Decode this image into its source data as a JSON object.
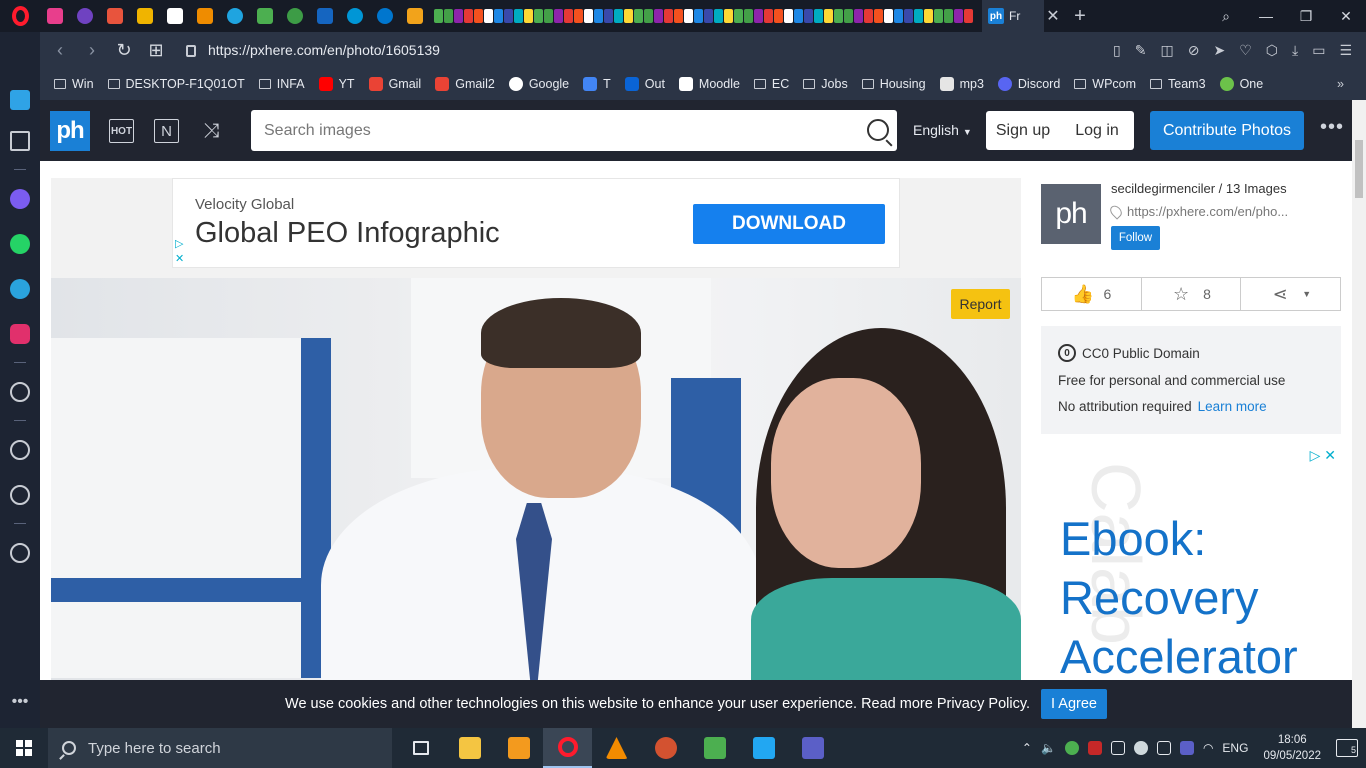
{
  "browser": {
    "active_tab_label": "Fr",
    "active_tab_favicon": "ph",
    "url": "https://pxhere.com/en/photo/1605139"
  },
  "bookmarks": [
    {
      "label": "Win",
      "icon": "folder-icon"
    },
    {
      "label": "DESKTOP-F1Q01OT",
      "icon": "folder-icon"
    },
    {
      "label": "INFA",
      "icon": "folder-icon"
    },
    {
      "label": "YT",
      "icon": "youtube-icon",
      "color": "#ff0000"
    },
    {
      "label": "Gmail",
      "icon": "gmail-icon",
      "color": "#ea4335"
    },
    {
      "label": "Gmail2",
      "icon": "gmail-icon",
      "color": "#ea4335"
    },
    {
      "label": "Google",
      "icon": "google-icon",
      "color": "#ffffff"
    },
    {
      "label": "T",
      "icon": "translate-icon",
      "color": "#4285f4"
    },
    {
      "label": "Out",
      "icon": "outlook-icon",
      "color": "#0a64d6"
    },
    {
      "label": "Moodle",
      "icon": "moodle-icon",
      "color": "#ffffff"
    },
    {
      "label": "EC",
      "icon": "folder-icon"
    },
    {
      "label": "Jobs",
      "icon": "folder-icon"
    },
    {
      "label": "Housing",
      "icon": "folder-icon"
    },
    {
      "label": "mp3",
      "icon": "music-icon",
      "color": "#e5e5e5"
    },
    {
      "label": "Discord",
      "icon": "discord-icon",
      "color": "#5865f2"
    },
    {
      "label": "WPcom",
      "icon": "folder-icon"
    },
    {
      "label": "Team3",
      "icon": "folder-icon"
    },
    {
      "label": "One",
      "icon": "circle-icon",
      "color": "#6cc24a"
    }
  ],
  "header": {
    "logo": "ph",
    "hot_label": "HOT",
    "new_label": "N",
    "search_placeholder": "Search images",
    "language": "English",
    "signup": "Sign up",
    "login": "Log in",
    "contribute": "Contribute Photos"
  },
  "ad_banner": {
    "sponsor": "Velocity Global",
    "headline": "Global PEO Infographic",
    "cta": "DOWNLOAD"
  },
  "photo": {
    "report_label": "Report"
  },
  "author": {
    "avatar_text": "ph",
    "name_line": "secildegirmenciler / 13 Images",
    "url": "https://pxhere.com/en/pho...",
    "follow_label": "Follow"
  },
  "stats": {
    "likes": "6",
    "favorites": "8"
  },
  "license": {
    "icon_text": "0",
    "title": "CC0 Public Domain",
    "line1": "Free for personal and commercial use",
    "line2": "No attribution required",
    "learn_more": "Learn more"
  },
  "side_ad": {
    "watermark": "Calab",
    "headline_1": "Ebook:",
    "headline_2": "Recovery",
    "headline_3": "Accelerator"
  },
  "cookie": {
    "text": "We use cookies and other technologies on this website to enhance your user experience. Read more Privacy Policy.",
    "agree": "I Agree"
  },
  "taskbar": {
    "search_placeholder": "Type here to search",
    "language": "ENG",
    "time": "18:06",
    "date": "09/05/2022",
    "notifications": "5"
  },
  "colors": {
    "brand_blue": "#1a80d6",
    "report_yellow": "#f5c211",
    "opera_red": "#ff1b2d"
  }
}
